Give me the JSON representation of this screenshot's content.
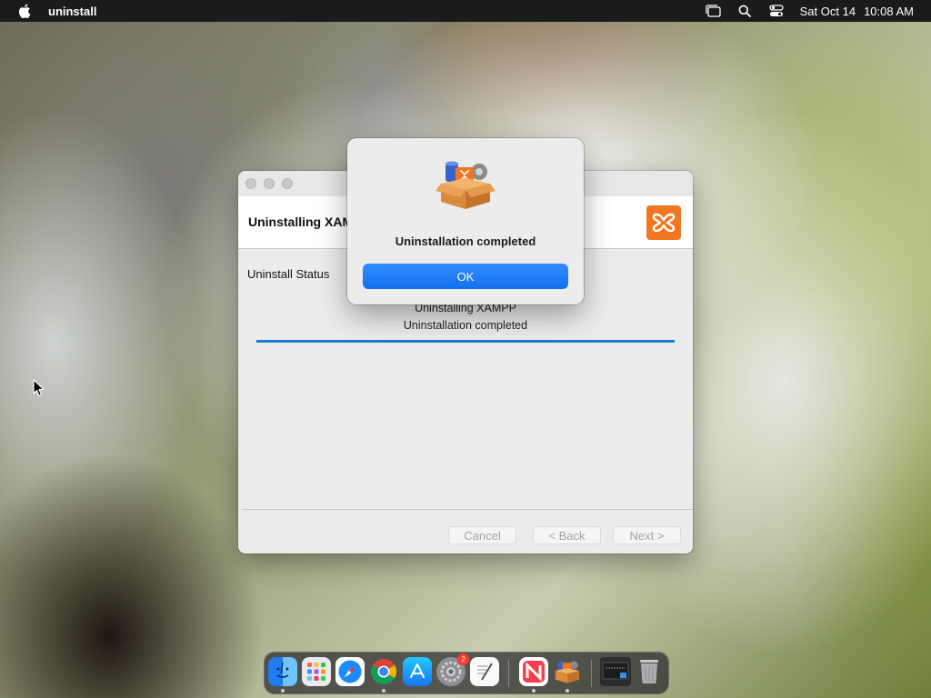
{
  "menubar": {
    "app_name": "uninstall",
    "date": "Sat Oct 14",
    "time": "10:08 AM",
    "icons": [
      "apple-icon",
      "window-switcher-icon",
      "spotlight-search-icon",
      "control-center-icon"
    ]
  },
  "installer": {
    "header_title": "Uninstalling XAMPP",
    "status_label": "Uninstall Status",
    "progress_line1": "Uninstalling XAMPP",
    "progress_line2": "Uninstallation completed",
    "progress_percent": 100,
    "buttons": {
      "cancel": "Cancel",
      "back": "< Back",
      "next": "Next >"
    }
  },
  "alert": {
    "message": "Uninstallation completed",
    "ok_label": "OK"
  },
  "dock": {
    "items": [
      "finder",
      "launchpad",
      "safari",
      "chrome",
      "app-store",
      "system-settings",
      "textedit",
      "news",
      "xampp-installer",
      "screen-thumbnail",
      "trash"
    ],
    "settings_badge": "2"
  },
  "colors": {
    "accent": "#1471ee",
    "progress": "#1b7bd1",
    "xampp_orange": "#f07622",
    "menubar_bg": "#1b1b1d"
  }
}
